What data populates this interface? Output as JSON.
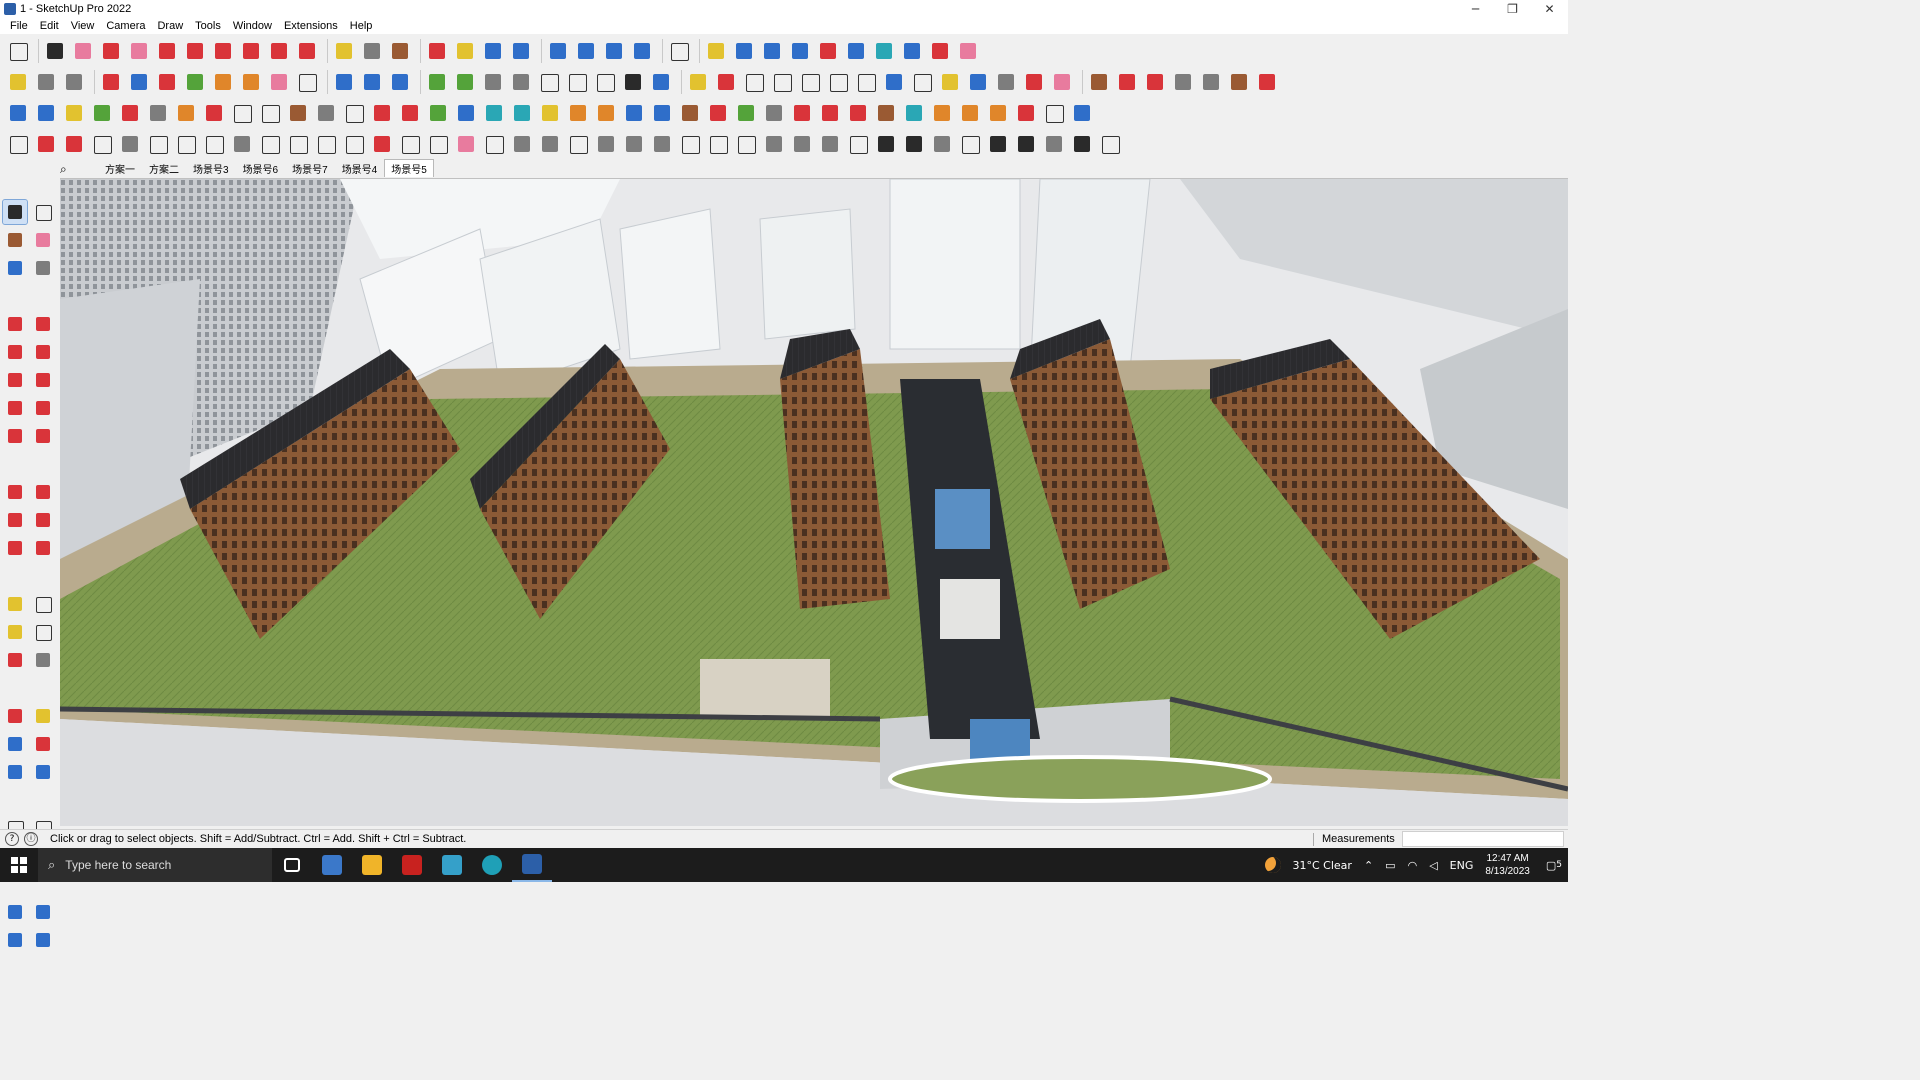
{
  "window": {
    "title": "1 - SketchUp Pro 2022",
    "minimize": "─",
    "maximize": "❐",
    "close": "✕"
  },
  "menu": [
    "File",
    "Edit",
    "View",
    "Camera",
    "Draw",
    "Tools",
    "Window",
    "Extensions",
    "Help"
  ],
  "scenes": {
    "tabs": [
      "方案一",
      "方案二",
      "场景号3",
      "场景号6",
      "场景号7",
      "场景号4",
      "场景号5"
    ],
    "active_index": 6
  },
  "status": {
    "info_icon": "ⓘ",
    "hint": "Click or drag to select objects. Shift = Add/Subtract. Ctrl = Add. Shift + Ctrl = Subtract.",
    "measurements_label": "Measurements",
    "measurements_value": ""
  },
  "taskbar": {
    "search_placeholder": "Type here to search",
    "weather": "31°C  Clear",
    "language": "ENG",
    "time": "12:47 AM",
    "date": "8/13/2023",
    "notifications": "5"
  },
  "icons": {
    "search": "search-icon",
    "select": "select-arrow-icon",
    "orbit": "orbit-icon",
    "pan": "pan-icon",
    "zoom": "zoom-icon",
    "paint": "paint-bucket-icon",
    "eraser": "eraser-icon",
    "pencil": "pencil-icon",
    "move": "move-icon",
    "rotate": "rotate-icon",
    "pushpull": "push-pull-icon",
    "tape": "tape-measure-icon"
  }
}
